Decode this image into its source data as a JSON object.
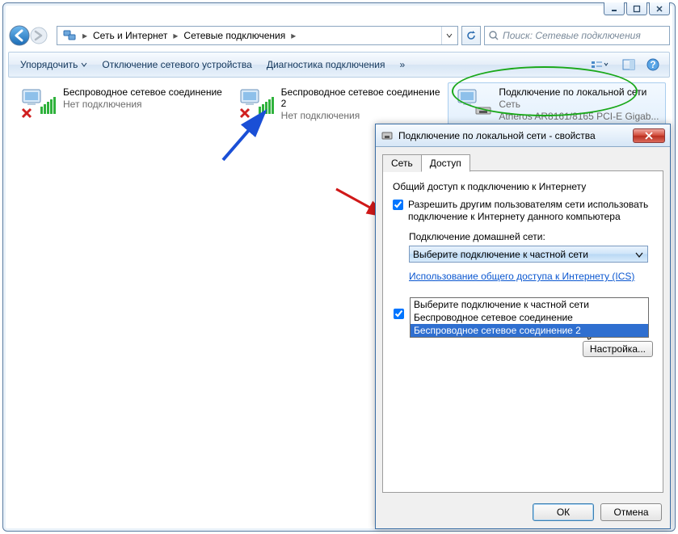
{
  "breadcrumb": {
    "a": "Сеть и Интернет",
    "b": "Сетевые подключения"
  },
  "search": {
    "placeholder": "Поиск: Сетевые подключения"
  },
  "toolbar": {
    "organize": "Упорядочить",
    "disable": "Отключение сетевого устройства",
    "diagnose": "Диагностика подключения",
    "chevrons": "»"
  },
  "connections": [
    {
      "title": "Беспроводное сетевое соединение",
      "status": "Нет подключения",
      "sub": ""
    },
    {
      "title": "Беспроводное сетевое соединение 2",
      "status": "Нет подключения",
      "sub": ""
    },
    {
      "title": "Подключение по локальной сети",
      "status": "Сеть",
      "sub": "Atheros AR8161/8165 PCI-E Gigab..."
    }
  ],
  "dialog": {
    "title": "Подключение по локальной сети - свойства",
    "tabs": {
      "net": "Сеть",
      "access": "Доступ"
    },
    "group": "Общий доступ к подключению к Интернету",
    "chk1": "Разрешить другим пользователям сети использовать подключение к Интернету данного компьютера",
    "home_label": "Подключение домашней сети:",
    "combo_text": "Выберите подключение к частной сети",
    "dd": {
      "o1": "Выберите подключение к частной сети",
      "o2": "Беспроводное сетевое соединение",
      "o3": "Беспроводное сетевое соединение 2"
    },
    "link": "Использование общего доступа к Интернету (ICS)",
    "settings": "Настройка...",
    "ok": "ОК",
    "cancel": "Отмена"
  }
}
